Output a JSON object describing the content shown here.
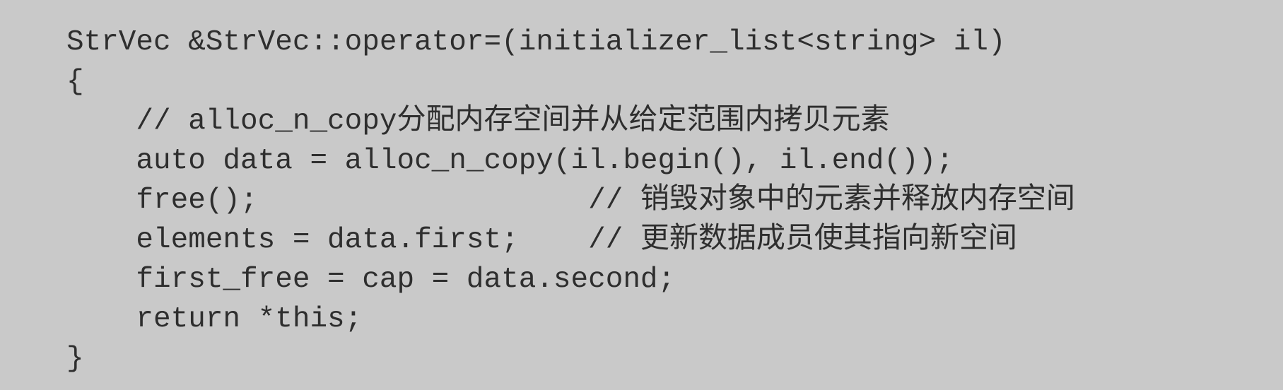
{
  "code_lines": [
    "StrVec &StrVec::operator=(initializer_list<string> il)",
    "{",
    "    // alloc_n_copy分配内存空间并从给定范围内拷贝元素",
    "    auto data = alloc_n_copy(il.begin(), il.end());",
    "    free();                   // 销毁对象中的元素并释放内存空间",
    "    elements = data.first;    // 更新数据成员使其指向新空间",
    "    first_free = cap = data.second;",
    "    return *this;",
    "}"
  ]
}
